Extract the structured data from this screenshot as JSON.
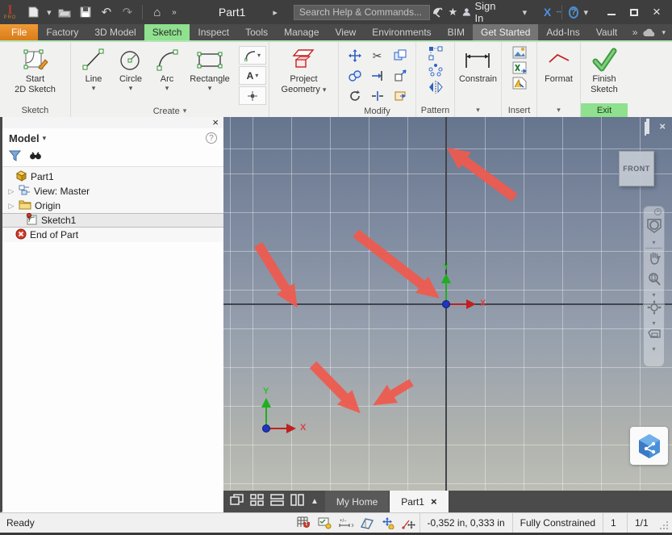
{
  "titlebar": {
    "badge_i": "I",
    "badge": "PRO",
    "doc_title": "Part1",
    "search_placeholder": "Search Help & Commands...",
    "sign_in": "Sign In"
  },
  "glyphs": {
    "caret_down": "▾",
    "caret_right": "▸",
    "chevrons_right": "»",
    "home": "⌂",
    "undo": "↶",
    "redo": "↷",
    "star": "★",
    "close": "×",
    "question": "?",
    "scissors": "✂",
    "expander": "▷",
    "triangle_up": "▲",
    "letter_a": "A",
    "exchange_x": "X",
    "exchange_arrows": "↔"
  },
  "colors": {
    "tab_active_green": "#8fe08f",
    "file_tab_orange": "#e8872a",
    "annotation_arrow_red": "#f05a4e",
    "axis_x_red": "#c02020",
    "axis_y_green": "#1faf1f",
    "origin_blue": "#1d36c8"
  },
  "tabs": {
    "items": [
      {
        "label": "File"
      },
      {
        "label": "Factory"
      },
      {
        "label": "3D Model"
      },
      {
        "label": "Sketch"
      },
      {
        "label": "Inspect"
      },
      {
        "label": "Tools"
      },
      {
        "label": "Manage"
      },
      {
        "label": "View"
      },
      {
        "label": "Environments"
      },
      {
        "label": "BIM"
      },
      {
        "label": "Get Started"
      },
      {
        "label": "Add-Ins"
      },
      {
        "label": "Vault"
      }
    ]
  },
  "ribbon": {
    "sketch": {
      "line1": "Start",
      "line2": "2D Sketch",
      "panel_label": "Sketch"
    },
    "create": {
      "tools": [
        {
          "label": "Line"
        },
        {
          "label": "Circle"
        },
        {
          "label": "Arc"
        },
        {
          "label": "Rectangle"
        }
      ],
      "panel_label": "Create"
    },
    "project": {
      "line1": "Project",
      "line2": "Geometry"
    },
    "modify": {
      "panel_label": "Modify"
    },
    "pattern": {
      "panel_label": "Pattern"
    },
    "constrain": {
      "label": "Constrain"
    },
    "insert": {
      "panel_label": "Insert"
    },
    "format": {
      "label": "Format"
    },
    "exit": {
      "line1": "Finish",
      "line2": "Sketch",
      "panel_label": "Exit"
    }
  },
  "browser": {
    "header": "Model",
    "tree": [
      {
        "label": "Part1"
      },
      {
        "label": "View: Master"
      },
      {
        "label": "Origin"
      },
      {
        "label": "Sketch1"
      },
      {
        "label": "End of Part"
      }
    ]
  },
  "viewport": {
    "viewcube": "FRONT",
    "axis_x": "X",
    "axis_y": "Y"
  },
  "tabbar": {
    "tabs": [
      {
        "label": "My Home"
      },
      {
        "label": "Part1"
      }
    ]
  },
  "statusbar": {
    "ready": "Ready",
    "coords": "-0,352 in, 0,333 in",
    "constraint_status": "Fully Constrained",
    "dim_display": "1",
    "sheet": "1/1"
  }
}
